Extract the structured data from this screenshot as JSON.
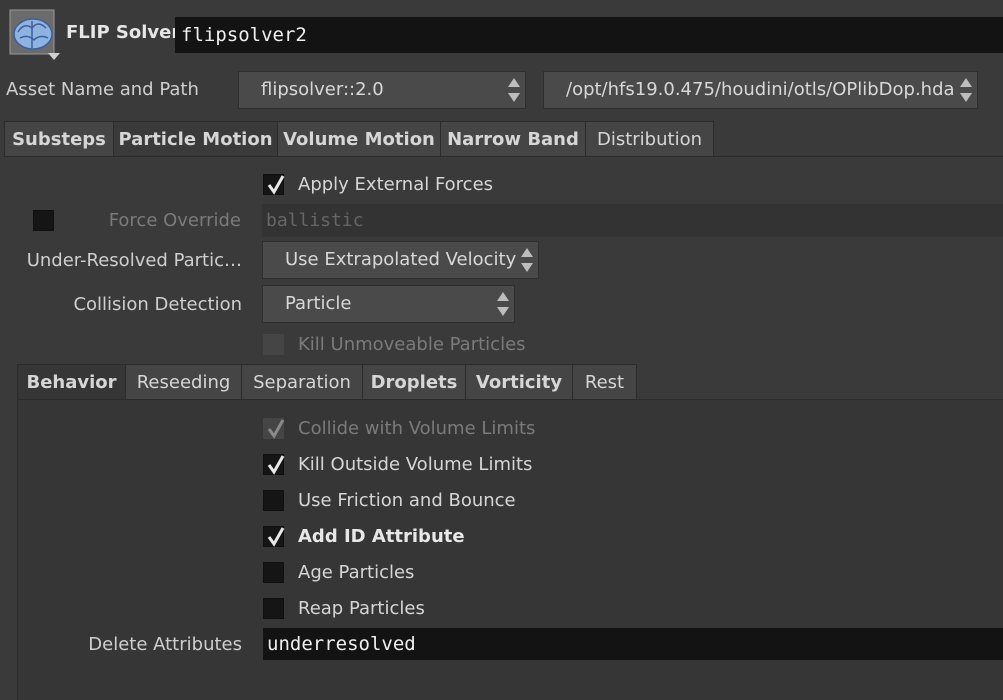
{
  "header": {
    "node_type": "FLIP Solver",
    "node_name": "flipsolver2",
    "icon": "brain-icon"
  },
  "asset": {
    "label": "Asset Name and Path",
    "name_value": "flipsolver::2.0",
    "path_value": "/opt/hfs19.0.475/houdini/otls/OPlibDop.hda"
  },
  "main_tabs": [
    {
      "label": "Substeps"
    },
    {
      "label": "Particle Motion"
    },
    {
      "label": "Volume Motion"
    },
    {
      "label": "Narrow Band"
    },
    {
      "label": "Distribution"
    }
  ],
  "particle_motion": {
    "apply_external_forces": {
      "label": "Apply External Forces",
      "checked": true
    },
    "force_override": {
      "label": "Force Override",
      "value": "ballistic"
    },
    "under_resolved": {
      "label": "Under-Resolved Partic…",
      "value": "Use Extrapolated Velocity"
    },
    "collision_detection": {
      "label": "Collision Detection",
      "value": "Particle"
    },
    "kill_unmoveable": {
      "label": "Kill Unmoveable Particles"
    }
  },
  "sub_tabs": [
    {
      "label": "Behavior"
    },
    {
      "label": "Reseeding"
    },
    {
      "label": "Separation"
    },
    {
      "label": "Droplets"
    },
    {
      "label": "Vorticity"
    },
    {
      "label": "Rest"
    }
  ],
  "behavior": {
    "collide_volume_limits": {
      "label": "Collide with Volume Limits",
      "checked": true
    },
    "kill_outside_limits": {
      "label": "Kill Outside Volume Limits",
      "checked": true
    },
    "use_friction_bounce": {
      "label": "Use Friction and Bounce",
      "checked": false
    },
    "add_id_attribute": {
      "label": "Add ID Attribute",
      "checked": true
    },
    "age_particles": {
      "label": "Age Particles",
      "checked": false
    },
    "reap_particles": {
      "label": "Reap Particles",
      "checked": false
    },
    "delete_attributes": {
      "label": "Delete Attributes",
      "value": "underresolved"
    }
  }
}
